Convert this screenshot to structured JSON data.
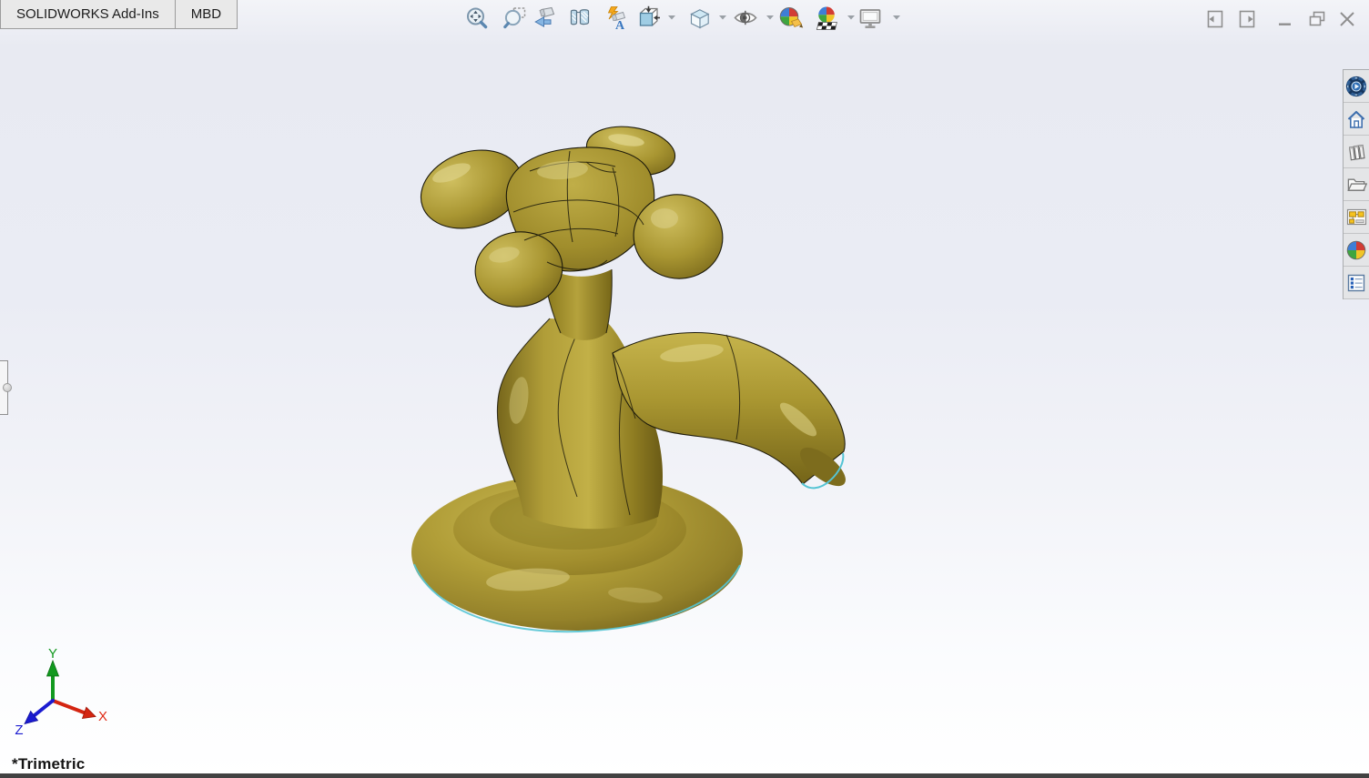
{
  "command_tabs": [
    {
      "label": "SOLIDWORKS Add-Ins"
    },
    {
      "label": "MBD"
    }
  ],
  "headsup_toolbar": {
    "annotation_letter": "A",
    "items": [
      {
        "icon": "zoom-to-fit-icon",
        "has_dropdown": false
      },
      {
        "icon": "zoom-to-area-icon",
        "has_dropdown": false
      },
      {
        "icon": "previous-view-icon",
        "has_dropdown": false
      },
      {
        "icon": "section-view-icon",
        "has_dropdown": false
      },
      {
        "icon": "dynamic-annotation-views-icon",
        "has_dropdown": false
      },
      {
        "icon": "cube-inward-arrows-icon",
        "has_dropdown": true
      },
      {
        "icon": "view-orientation-cube-icon",
        "has_dropdown": true
      },
      {
        "icon": "hide-show-items-eye-icon",
        "has_dropdown": true
      },
      {
        "icon": "edit-appearance-sphere-pencil-icon",
        "has_dropdown": false
      },
      {
        "icon": "apply-scene-sphere-checker-icon",
        "has_dropdown": true
      },
      {
        "icon": "view-settings-monitor-icon",
        "has_dropdown": true
      }
    ]
  },
  "window_controls": {
    "items": [
      "collapse-left-pane-icon",
      "collapse-right-pane-icon",
      "minimize-icon",
      "restore-icon",
      "close-icon"
    ]
  },
  "task_pane": {
    "items": [
      "circular-play-resources-icon",
      "home-icon",
      "design-library-books-icon",
      "file-explorer-folder-icon",
      "view-palette-icon",
      "appearances-sphere-icon",
      "custom-properties-form-icon"
    ]
  },
  "viewport": {
    "orientation_label": "*Trimetric",
    "triad": {
      "x_label": "X",
      "y_label": "Y",
      "z_label": "Z",
      "x_color": "#e02a14",
      "y_color": "#12991f",
      "z_color": "#1b1bd0"
    },
    "model": {
      "subject": "brass-faucet-with-cross-handle",
      "body_color": "#a5922e",
      "edge_color": "#1b190b",
      "silhouette_highlight_color": "#55c4d4"
    }
  },
  "colors": {
    "background_top": "#e8eaf2",
    "background_bottom": "#ffffff",
    "tab_background": "#e9e9e9",
    "tab_border": "#9c9c9c",
    "bottom_strip": "#424242"
  }
}
